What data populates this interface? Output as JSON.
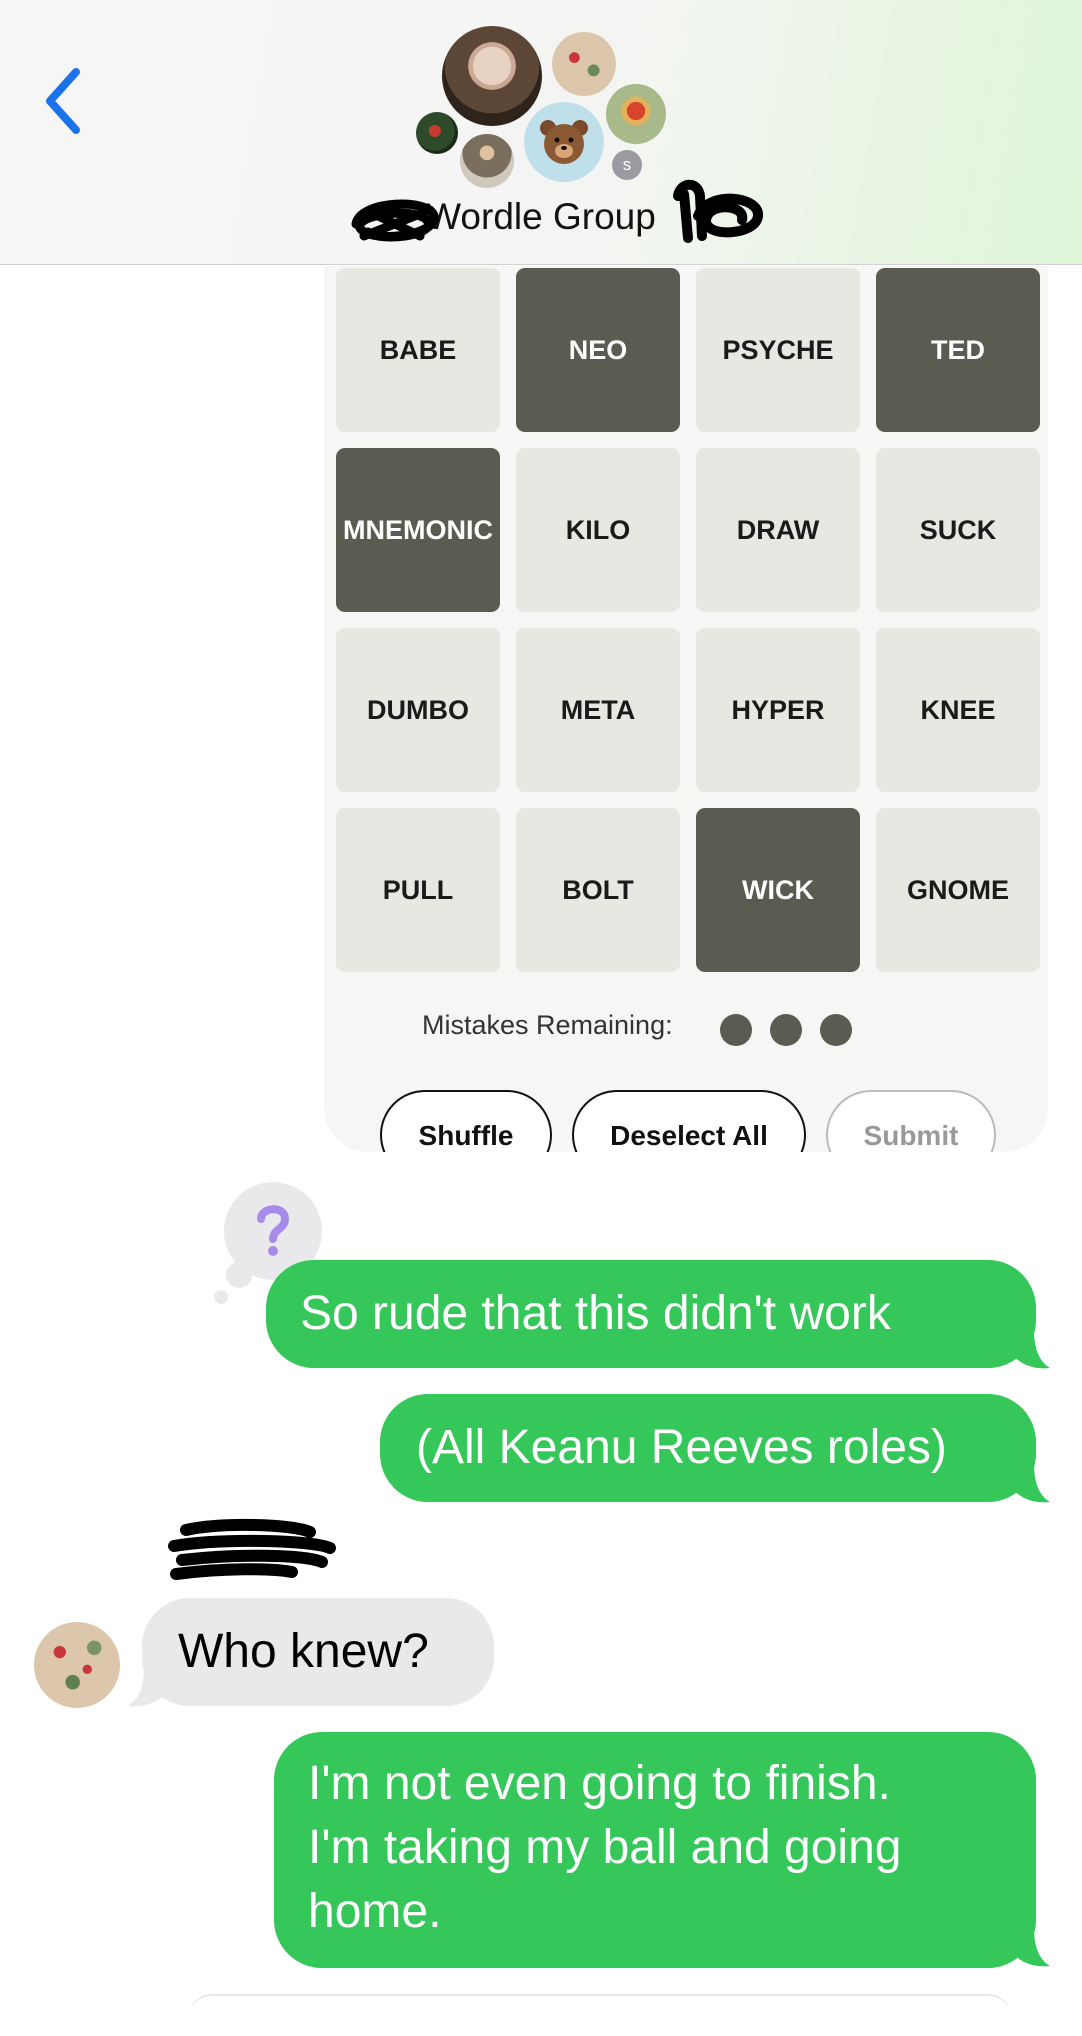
{
  "header": {
    "back_icon": "chevron-left-icon",
    "title": "Wordle Group",
    "small_avatar_initial": "s",
    "accent": "#1a73e8"
  },
  "game": {
    "tiles": [
      {
        "word": "BABE",
        "selected": false
      },
      {
        "word": "NEO",
        "selected": true
      },
      {
        "word": "PSYCHE",
        "selected": false
      },
      {
        "word": "TED",
        "selected": true
      },
      {
        "word": "MNEMONIC",
        "selected": true
      },
      {
        "word": "KILO",
        "selected": false
      },
      {
        "word": "DRAW",
        "selected": false
      },
      {
        "word": "SUCK",
        "selected": false
      },
      {
        "word": "DUMBO",
        "selected": false
      },
      {
        "word": "META",
        "selected": false
      },
      {
        "word": "HYPER",
        "selected": false
      },
      {
        "word": "KNEE",
        "selected": false
      },
      {
        "word": "PULL",
        "selected": false
      },
      {
        "word": "BOLT",
        "selected": false
      },
      {
        "word": "WICK",
        "selected": true
      },
      {
        "word": "GNOME",
        "selected": false
      }
    ],
    "mistakes_label": "Mistakes Remaining:",
    "mistakes_remaining": 3,
    "buttons": {
      "shuffle": "Shuffle",
      "deselect": "Deselect All",
      "submit": "Submit"
    }
  },
  "messages": {
    "reaction_icon": "question-mark-icon",
    "m1": "So rude that this didn't work",
    "m2": "(All Keanu Reeves roles)",
    "m3": "Who knew?",
    "m4_l1": "I'm not even going to finish.",
    "m4_l2": "I'm taking my ball and going",
    "m4_l3": "home."
  },
  "colors": {
    "outgoing": "#35c759",
    "incoming": "#e9e9eb",
    "selected_tile": "#5b5b52",
    "tile": "#e8e7e1"
  }
}
